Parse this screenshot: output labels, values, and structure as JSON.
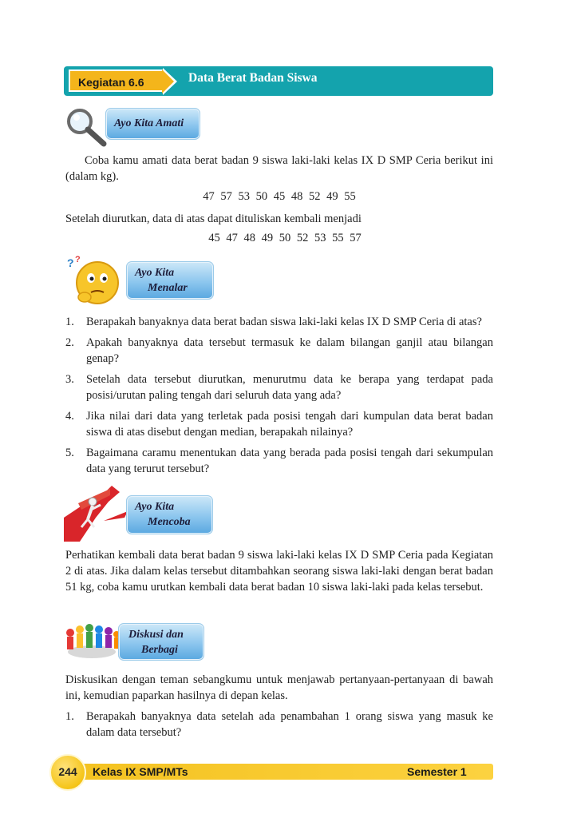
{
  "header": {
    "kegiatan_label": "Kegiatan 6.6",
    "title": "Data Berat Badan Siswa"
  },
  "amati": {
    "icon": "magnifier-icon",
    "label": "Ayo Kita Amati",
    "paragraph": "Coba kamu amati data berat badan 9 siswa laki-laki kelas IX D SMP Ceria berikut ini (dalam kg).",
    "data_line": "47  57  53  50  45  48  52  49  55",
    "sorted_intro": "Setelah diurutkan, data di atas dapat dituliskan kembali menjadi",
    "sorted_line": "45  47  48  49  50  52  53  55  57"
  },
  "menalar": {
    "icon": "thinking-face-icon",
    "label_line1": "Ayo Kita",
    "label_line2": "Menalar",
    "questions": [
      {
        "num": "1.",
        "text": "Berapakah banyaknya data berat badan siswa laki-laki kelas IX D SMP Ceria di atas?"
      },
      {
        "num": "2.",
        "text": "Apakah banyaknya data tersebut termasuk ke dalam bilangan ganjil atau bilangan genap?"
      },
      {
        "num": "3.",
        "text": "Setelah data tersebut diurutkan, menurutmu data ke berapa yang terdapat pada posisi/urutan paling tengah dari seluruh data yang ada?"
      },
      {
        "num": "4.",
        "text": "Jika nilai dari data yang terletak pada posisi tengah dari kumpulan data berat badan siswa di atas disebut dengan median, berapakah nilainya?"
      },
      {
        "num": "5.",
        "text": "Bagaimana caramu menentukan data yang berada pada posisi tengah dari sekumpulan data yang terurut tersebut?"
      }
    ]
  },
  "mencoba": {
    "icon": "climbing-person-icon",
    "label_line1": "Ayo Kita",
    "label_line2": "Mencoba",
    "paragraph": "Perhatikan kembali data berat badan 9 siswa laki-laki kelas IX D SMP Ceria pada Kegiatan 2 di atas. Jika dalam kelas tersebut ditambahkan seorang siswa laki-laki dengan berat badan 51 kg, coba kamu urutkan kembali data berat badan 10 siswa laki-laki pada kelas tersebut."
  },
  "diskusi": {
    "icon": "discussion-group-icon",
    "label_line1": "Diskusi dan",
    "label_line2": "Berbagi",
    "paragraph": "Diskusikan dengan teman sebangkumu untuk menjawab pertanyaan-pertanyaan di bawah ini, kemudian paparkan hasilnya di depan kelas.",
    "questions": [
      {
        "num": "1.",
        "text": "Berapakah banyaknya data setelah ada penambahan 1 orang siswa yang masuk ke dalam data tersebut?"
      }
    ]
  },
  "footer": {
    "page_number": "244",
    "book_title": "Kelas IX SMP/MTs",
    "semester": "Semester 1"
  },
  "colors": {
    "header_teal": "#14a3ad",
    "kegiatan_yellow": "#f4b51b",
    "box_blue": "#8cc6ee",
    "footer_yellow": "#f4c220"
  }
}
